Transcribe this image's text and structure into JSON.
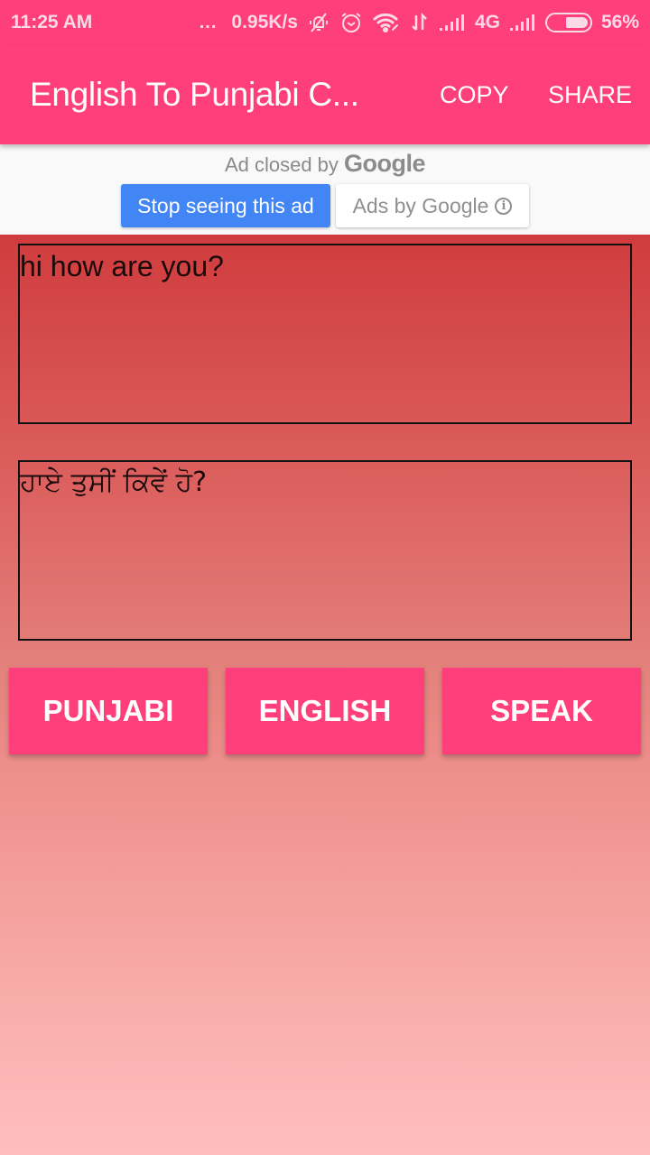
{
  "status_bar": {
    "time": "11:25 AM",
    "dots": "...",
    "network_speed": "0.95K/s",
    "network_type": "4G",
    "battery": "56%",
    "battery_level": 0.56,
    "icons": [
      "notifications-muted-icon",
      "alarm-icon",
      "wifi-icon",
      "data-transfer-icon",
      "signal-icon",
      "signal-icon",
      "battery-icon"
    ]
  },
  "app_bar": {
    "title": "English To Punjabi C...",
    "actions": [
      {
        "label": "COPY"
      },
      {
        "label": "SHARE"
      }
    ]
  },
  "ad": {
    "closed_prefix": "Ad closed by",
    "closed_brand": "Google",
    "stop_seeing_label": "Stop seeing this ad",
    "ads_by_label": "Ads by Google",
    "info_glyph": "i"
  },
  "translator": {
    "input_text": "hi how are you?",
    "output_text": "ਹਾਏ ਤੁਸੀਂ ਕਿਵੇਂ ਹੋ?"
  },
  "buttons": [
    {
      "label": "PUNJABI"
    },
    {
      "label": "ENGLISH"
    },
    {
      "label": "SPEAK"
    }
  ],
  "colors": {
    "primary": "#fe3f7c",
    "ad_button": "#4285f4",
    "background_top": "#d03c3e",
    "background_bottom": "#ffbebe"
  }
}
